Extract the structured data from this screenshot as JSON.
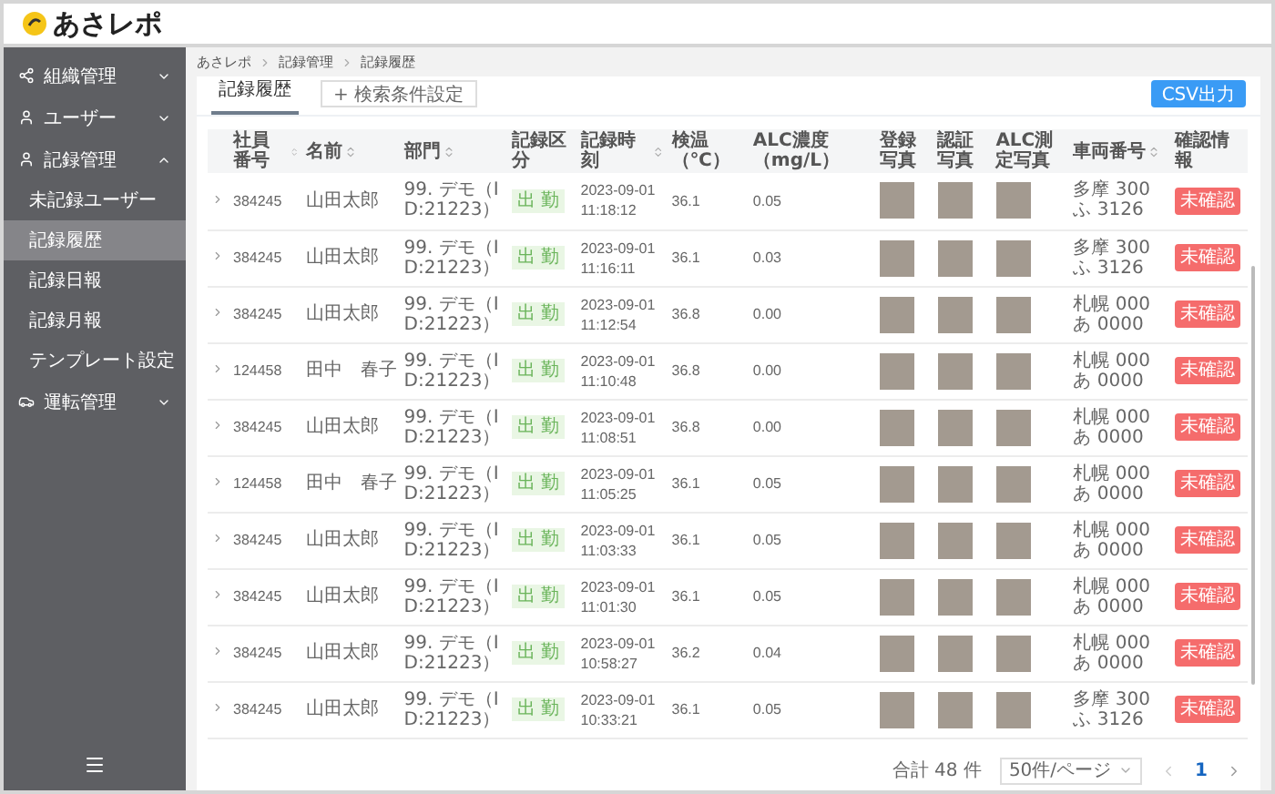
{
  "app": {
    "logo_text": "あさレポ"
  },
  "sidebar": {
    "items": [
      {
        "label": "組織管理",
        "expanded": false
      },
      {
        "label": "ユーザー",
        "expanded": false
      },
      {
        "label": "記録管理",
        "expanded": true,
        "children": [
          {
            "label": "未記録ユーザー",
            "selected": false
          },
          {
            "label": "記録履歴",
            "selected": true
          },
          {
            "label": "記録日報",
            "selected": false
          },
          {
            "label": "記録月報",
            "selected": false
          },
          {
            "label": "テンプレート設定",
            "selected": false
          }
        ]
      },
      {
        "label": "運転管理",
        "expanded": false
      }
    ]
  },
  "breadcrumb": [
    "あさレポ",
    "記録管理",
    "記録履歴"
  ],
  "tabs": [
    {
      "label": "記録履歴",
      "selected": true
    }
  ],
  "search_button": "+ 検索条件設定",
  "csv_button": "CSV出力",
  "table": {
    "columns": [
      {
        "label": "社員番号",
        "sortable": true
      },
      {
        "label": "名前",
        "sortable": true
      },
      {
        "label": "部門",
        "sortable": true
      },
      {
        "label": "記録区分",
        "sortable": false
      },
      {
        "label": "記録時刻",
        "sortable": true
      },
      {
        "label": "検温（℃）",
        "sortable": false
      },
      {
        "label": "ALC濃度（mg/L）",
        "sortable": false
      },
      {
        "label": "登録写真",
        "sortable": false
      },
      {
        "label": "認証写真",
        "sortable": false
      },
      {
        "label": "ALC測定写真",
        "sortable": false
      },
      {
        "label": "車両番号",
        "sortable": true
      },
      {
        "label": "確認情報",
        "sortable": false
      }
    ],
    "rows": [
      {
        "employee_no": "384245",
        "name": "山田太郎",
        "department": "99. デモ（ID:21223）",
        "record_type": "出 勤",
        "record_time": "2023-09-01 11:18:12",
        "temperature": "36.1",
        "alc": "0.05",
        "vehicle_no": "多摩 300 ふ 3126",
        "status": "未確認"
      },
      {
        "employee_no": "384245",
        "name": "山田太郎",
        "department": "99. デモ（ID:21223）",
        "record_type": "出 勤",
        "record_time": "2023-09-01 11:16:11",
        "temperature": "36.1",
        "alc": "0.03",
        "vehicle_no": "多摩 300 ふ 3126",
        "status": "未確認"
      },
      {
        "employee_no": "384245",
        "name": "山田太郎",
        "department": "99. デモ（ID:21223）",
        "record_type": "出 勤",
        "record_time": "2023-09-01 11:12:54",
        "temperature": "36.8",
        "alc": "0.00",
        "vehicle_no": "札幌 000 あ 0000",
        "status": "未確認"
      },
      {
        "employee_no": "124458",
        "name": "田中　春子",
        "department": "99. デモ（ID:21223）",
        "record_type": "出 勤",
        "record_time": "2023-09-01 11:10:48",
        "temperature": "36.8",
        "alc": "0.00",
        "vehicle_no": "札幌 000 あ 0000",
        "status": "未確認"
      },
      {
        "employee_no": "384245",
        "name": "山田太郎",
        "department": "99. デモ（ID:21223）",
        "record_type": "出 勤",
        "record_time": "2023-09-01 11:08:51",
        "temperature": "36.8",
        "alc": "0.00",
        "vehicle_no": "札幌 000 あ 0000",
        "status": "未確認"
      },
      {
        "employee_no": "124458",
        "name": "田中　春子",
        "department": "99. デモ（ID:21223）",
        "record_type": "出 勤",
        "record_time": "2023-09-01 11:05:25",
        "temperature": "36.1",
        "alc": "0.05",
        "vehicle_no": "札幌 000 あ 0000",
        "status": "未確認"
      },
      {
        "employee_no": "384245",
        "name": "山田太郎",
        "department": "99. デモ（ID:21223）",
        "record_type": "出 勤",
        "record_time": "2023-09-01 11:03:33",
        "temperature": "36.1",
        "alc": "0.05",
        "vehicle_no": "札幌 000 あ 0000",
        "status": "未確認"
      },
      {
        "employee_no": "384245",
        "name": "山田太郎",
        "department": "99. デモ（ID:21223）",
        "record_type": "出 勤",
        "record_time": "2023-09-01 11:01:30",
        "temperature": "36.1",
        "alc": "0.05",
        "vehicle_no": "札幌 000 あ 0000",
        "status": "未確認"
      },
      {
        "employee_no": "384245",
        "name": "山田太郎",
        "department": "99. デモ（ID:21223）",
        "record_type": "出 勤",
        "record_time": "2023-09-01 10:58:27",
        "temperature": "36.2",
        "alc": "0.04",
        "vehicle_no": "札幌 000 あ 0000",
        "status": "未確認"
      },
      {
        "employee_no": "384245",
        "name": "山田太郎",
        "department": "99. デモ（ID:21223）",
        "record_type": "出 勤",
        "record_time": "2023-09-01 10:33:21",
        "temperature": "36.1",
        "alc": "0.05",
        "vehicle_no": "多摩 300 ふ 3126",
        "status": "未確認"
      }
    ]
  },
  "pagination": {
    "total": "合計 48 件",
    "page_size": "50件/ページ",
    "pages": [
      {
        "label": "1",
        "selected": true
      }
    ]
  }
}
